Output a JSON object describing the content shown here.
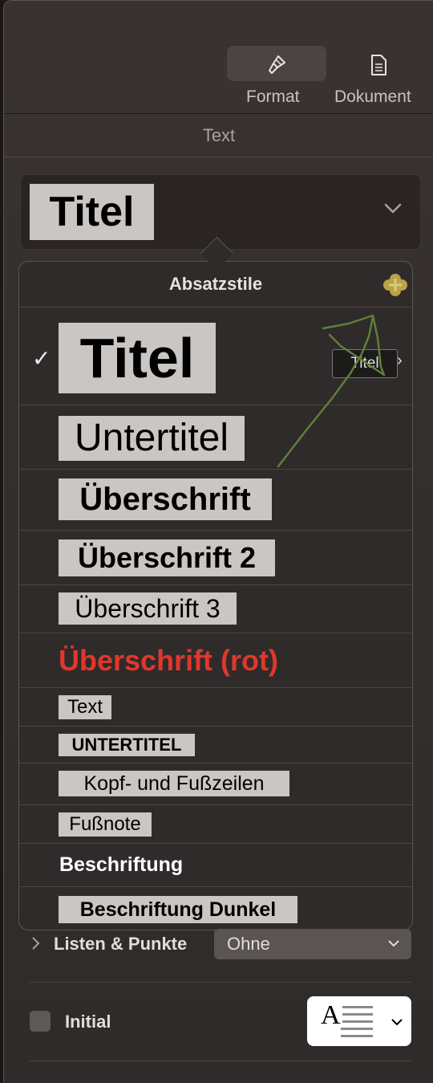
{
  "toolbar": {
    "tabs": [
      {
        "label": "Format",
        "icon": "paintbrush-icon",
        "active": true
      },
      {
        "label": "Dokument",
        "icon": "document-icon",
        "active": false
      }
    ]
  },
  "section": {
    "title": "Text"
  },
  "style_select": {
    "value": "Titel"
  },
  "popover": {
    "title": "Absatzstile",
    "tooltip": "Titel",
    "styles": [
      {
        "label": "Titel",
        "selected": true
      },
      {
        "label": "Untertitel"
      },
      {
        "label": "Überschrift"
      },
      {
        "label": "Überschrift 2"
      },
      {
        "label": "Überschrift 3"
      },
      {
        "label": "Überschrift (rot)",
        "color": "#e0372c"
      },
      {
        "label": "Text"
      },
      {
        "label": "UNTERTITEL"
      },
      {
        "label": "Kopf- und Fußzeilen"
      },
      {
        "label": "Fußnote"
      },
      {
        "label": "Beschriftung"
      },
      {
        "label": "Beschriftung Dunkel"
      }
    ]
  },
  "lists": {
    "label": "Listen & Punkte",
    "value": "Ohne"
  },
  "initial": {
    "label": "Initial",
    "checked": false
  },
  "colors": {
    "accent_plus": "#b8a24a",
    "annotation_arrow": "#5f7f3a"
  }
}
